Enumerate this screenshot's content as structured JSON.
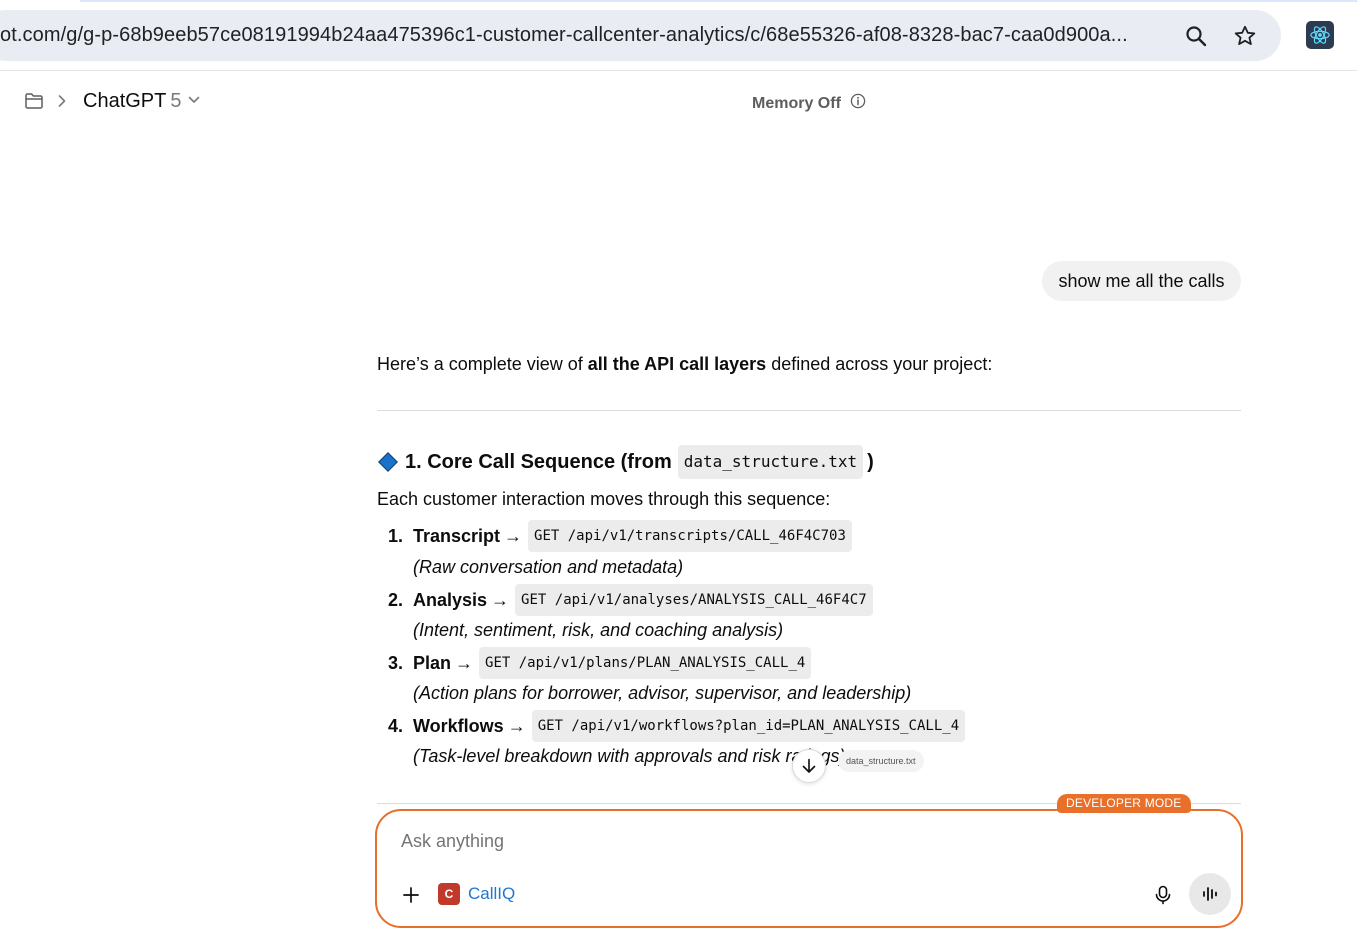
{
  "browser": {
    "url": "ot.com/g/g-p-68b9eeb57ce08191994b24aa475396c1-customer-callcenter-analytics/c/68e55326-af08-8328-bac7-caa0d900a..."
  },
  "header": {
    "model_name": "ChatGPT",
    "model_version": "5",
    "memory_status": "Memory Off"
  },
  "conversation": {
    "user_message": "show me all the calls",
    "assistant": {
      "intro_pre": "Here’s a complete view of ",
      "intro_bold": "all the API call layers",
      "intro_post": " defined across your project:",
      "section_title_pre": "1. Core Call Sequence (from",
      "section_title_code": "data_structure.txt",
      "section_title_post": ")",
      "paragraph": "Each customer interaction moves through this sequence:",
      "steps": [
        {
          "num": "1.",
          "label": "Transcript",
          "arrow": "→",
          "endpoint": "GET /api/v1/transcripts/CALL_46F4C703",
          "desc": "(Raw conversation and metadata)"
        },
        {
          "num": "2.",
          "label": "Analysis",
          "arrow": "→",
          "endpoint": "GET /api/v1/analyses/ANALYSIS_CALL_46F4C7",
          "desc": "(Intent, sentiment, risk, and coaching analysis)"
        },
        {
          "num": "3.",
          "label": "Plan",
          "arrow": "→",
          "endpoint": "GET /api/v1/plans/PLAN_ANALYSIS_CALL_4",
          "desc": "(Action plans for borrower, advisor, supervisor, and leadership)"
        },
        {
          "num": "4.",
          "label": "Workflows",
          "arrow": "→",
          "endpoint": "GET /api/v1/workflows?plan_id=PLAN_ANALYSIS_CALL_4",
          "desc": "(Task-level breakdown with approvals and risk ratings)"
        }
      ],
      "citation": "data_structure.txt"
    }
  },
  "composer": {
    "placeholder": "Ask anything",
    "mode_badge": "DEVELOPER MODE",
    "gpt_initial": "C",
    "gpt_name": "CallIQ"
  },
  "colors": {
    "accent": "#e8702a",
    "link": "#1f77d0",
    "diamond": "#1a73c9"
  }
}
